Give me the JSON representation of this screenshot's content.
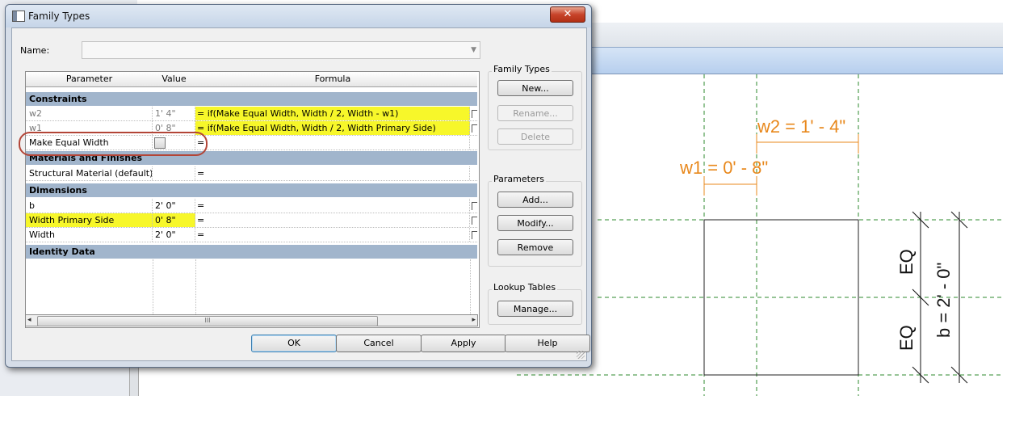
{
  "dialog": {
    "title": "Family Types",
    "close_label": "✕",
    "name_label": "Name:",
    "name_value": ""
  },
  "table": {
    "headers": [
      "Parameter",
      "Value",
      "Formula"
    ],
    "groups": {
      "constraints": "Constraints",
      "materials": "Materials and Finishes",
      "dimensions": "Dimensions",
      "identity": "Identity Data"
    },
    "rows": {
      "w2": {
        "parameter": "w2",
        "value": "1'  4\"",
        "formula": "= if(Make Equal Width, Width / 2, Width - w1)"
      },
      "w1": {
        "parameter": "w1",
        "value": "0'  8\"",
        "formula": "= if(Make Equal Width, Width / 2, Width Primary Side)"
      },
      "make_equal": {
        "parameter": "Make Equal Width",
        "value": "",
        "formula": "=",
        "checked": false
      },
      "material": {
        "parameter": "Structural Material (default)",
        "value": "",
        "formula": "="
      },
      "b": {
        "parameter": "b",
        "value": "2'  0\"",
        "formula": "="
      },
      "wps": {
        "parameter": "Width Primary Side",
        "value": "0'  8\"",
        "formula": "="
      },
      "width": {
        "parameter": "Width",
        "value": "2'  0\"",
        "formula": "="
      }
    },
    "scroll_left": "◂",
    "scroll_right": "▸",
    "scroll_grip": "III"
  },
  "family_types": {
    "title": "Family Types",
    "new": "New...",
    "rename": "Rename...",
    "delete": "Delete"
  },
  "parameters": {
    "title": "Parameters",
    "add": "Add...",
    "modify": "Modify...",
    "remove": "Remove"
  },
  "lookup": {
    "title": "Lookup Tables",
    "manage": "Manage..."
  },
  "footer": {
    "ok": "OK",
    "cancel": "Cancel",
    "apply": "Apply",
    "help": "Help"
  },
  "drawing": {
    "w2_label": "w2 = 1' - 4\"",
    "w1_label": "w1 = 0' - 8\"",
    "eq_top": "EQ",
    "eq_bottom": "EQ",
    "b_label": "b = 2' - 0\""
  },
  "colors": {
    "highlight": "#f7f72a",
    "group_header": "#a1b5cc",
    "dimension_orange": "#e8881c",
    "reference_green": "#2d8a2d",
    "annotation_red": "#b34537"
  }
}
